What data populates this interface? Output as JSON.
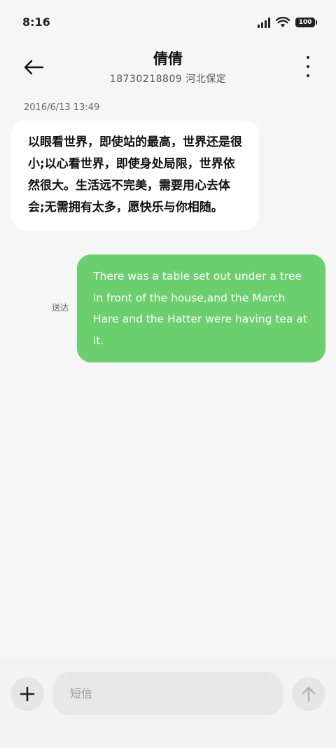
{
  "status_bar": {
    "time": "8:16",
    "battery": "100"
  },
  "header": {
    "contact_name": "倩倩",
    "contact_sub": "18730218809 河北保定"
  },
  "conversation": {
    "timestamp": "2016/6/13 13:49",
    "incoming_message": "以眼看世界，即使站的最高，世界还是很小;以心看世界，即使身处局限，世界依然很大。生活远不完美，需要用心去体会;无需拥有太多，愿快乐与你相随。",
    "outgoing_status": "送达",
    "outgoing_message": "There was a table set out under a tree in front of the house,and the March Hare and the Hatter were having tea at it."
  },
  "composer": {
    "placeholder": "短信"
  },
  "colors": {
    "background": "#f6f6f6",
    "incoming_bubble": "#ffffff",
    "outgoing_bubble": "#6ccf6e"
  },
  "icons": {
    "back": "arrow-left-icon",
    "more": "more-vertical-icon",
    "add": "plus-icon",
    "send": "arrow-up-icon",
    "signal": "signal-icon",
    "wifi": "wifi-icon",
    "battery": "battery-icon"
  }
}
